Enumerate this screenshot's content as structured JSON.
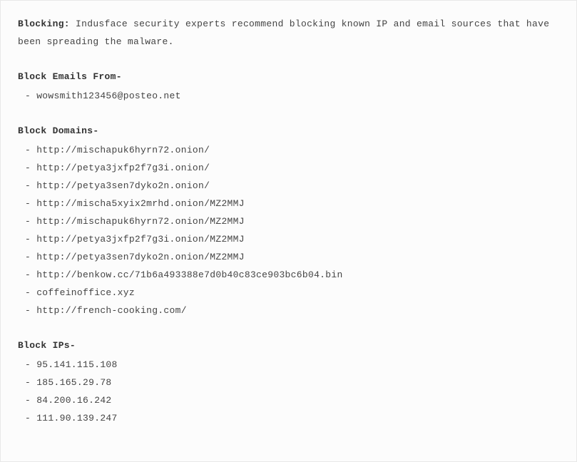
{
  "intro": {
    "label": "Blocking:",
    "text": " Indusface security experts recommend blocking known IP and email sources that have been spreading the malware."
  },
  "sections": [
    {
      "header": "Block Emails From-",
      "items": [
        "wowsmith123456@posteo.net"
      ]
    },
    {
      "header": "Block Domains-",
      "items": [
        "http://mischapuk6hyrn72.onion/",
        "http://petya3jxfp2f7g3i.onion/",
        "http://petya3sen7dyko2n.onion/",
        "http://mischa5xyix2mrhd.onion/MZ2MMJ",
        "http://mischapuk6hyrn72.onion/MZ2MMJ",
        "http://petya3jxfp2f7g3i.onion/MZ2MMJ",
        "http://petya3sen7dyko2n.onion/MZ2MMJ",
        "http://benkow.cc/71b6a493388e7d0b40c83ce903bc6b04.bin",
        "coffeinoffice.xyz",
        "http://french-cooking.com/"
      ]
    },
    {
      "header": "Block IPs-",
      "items": [
        "95.141.115.108",
        "185.165.29.78",
        "84.200.16.242",
        "111.90.139.247"
      ]
    }
  ]
}
